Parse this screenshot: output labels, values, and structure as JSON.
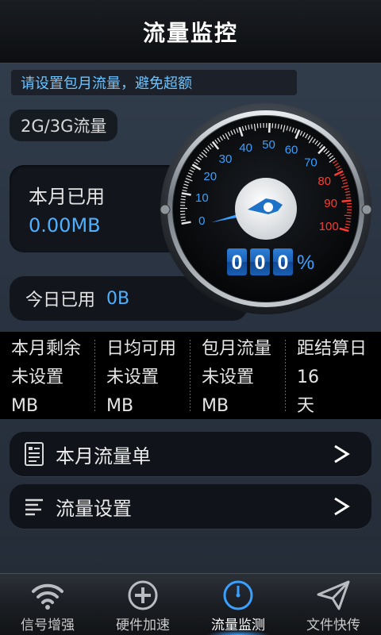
{
  "header": {
    "title": "流量监控"
  },
  "notice": "请设置包月流量，避免超额",
  "network_type": "2G/3G流量",
  "month_used": {
    "label": "本月已用",
    "value": "0.00MB"
  },
  "today_used": {
    "label": "今日已用",
    "value": "0B"
  },
  "gauge": {
    "scale_labels": [
      "0",
      "10",
      "20",
      "30",
      "40",
      "50",
      "60",
      "70",
      "80",
      "90",
      "100"
    ],
    "digits": [
      "0",
      "0",
      "0"
    ],
    "percent_sign": "%",
    "value_percent": 0,
    "colors": {
      "normal": "#3aa0ff",
      "warning": "#ff3b30"
    }
  },
  "stats": [
    {
      "label": "本月剩余",
      "value": "未设置",
      "unit": "MB"
    },
    {
      "label": "日均可用",
      "value": "未设置",
      "unit": "MB"
    },
    {
      "label": "包月流量",
      "value": "未设置",
      "unit": "MB"
    },
    {
      "label": "距结算日",
      "value": "16",
      "unit": "天"
    }
  ],
  "menu": [
    {
      "label": "本月流量单",
      "icon": "document-icon"
    },
    {
      "label": "流量设置",
      "icon": "settings-list-icon"
    }
  ],
  "tabs": [
    {
      "label": "信号增强",
      "icon": "wifi-signal-icon",
      "active": false
    },
    {
      "label": "硬件加速",
      "icon": "plus-circle-icon",
      "active": false
    },
    {
      "label": "流量监测",
      "icon": "clock-icon",
      "active": true
    },
    {
      "label": "文件快传",
      "icon": "send-icon",
      "active": false
    }
  ]
}
